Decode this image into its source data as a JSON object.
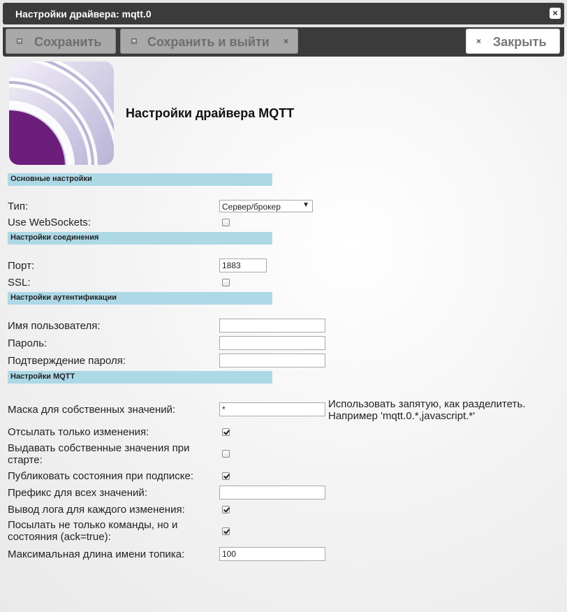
{
  "window": {
    "title": "Настройки драйвера: mqtt.0",
    "close_glyph": "×"
  },
  "toolbar": {
    "save_label": "Сохранить",
    "save_exit_label": "Сохранить и выйти",
    "close_label": "Закрыть",
    "x_glyph": "×"
  },
  "header": {
    "title": "Настройки драйвера MQTT",
    "logo_icon": "mqtt-logo-icon"
  },
  "sections": {
    "main": "Основные настройки",
    "connection": "Настройки соединения",
    "auth": "Настройки аутентификации",
    "mqtt": "Настройки MQTT"
  },
  "fields": {
    "type": {
      "label": "Тип:",
      "value": "Сервер/брокер",
      "arrow": "▼"
    },
    "websockets": {
      "label": "Use WebSockets:",
      "checked": false
    },
    "port": {
      "label": "Порт:",
      "value": "1883"
    },
    "ssl": {
      "label": "SSL:",
      "checked": false
    },
    "username": {
      "label": "Имя пользователя:",
      "value": ""
    },
    "password": {
      "label": "Пароль:",
      "value": ""
    },
    "password_confirm": {
      "label": "Подтверждение пароля:",
      "value": ""
    },
    "mask": {
      "label": "Маска для собственных значений:",
      "value": "*",
      "hint": "Использовать запятую, как разделитеть. Например 'mqtt.0.*,javascript.*'"
    },
    "only_changes": {
      "label": "Отсылать только изменения:",
      "checked": true
    },
    "initial_values": {
      "label": "Выдавать собственные значения при старте:",
      "checked": false
    },
    "publish_on_subscribe": {
      "label": "Публиковать состояния при подписке:",
      "checked": true
    },
    "prefix": {
      "label": "Префикс для всех значений:",
      "value": ""
    },
    "log_each_change": {
      "label": "Вывод лога для каждого изменения:",
      "checked": true
    },
    "send_ack_states": {
      "label": "Посылать не только команды, но и состояния (ack=true):",
      "checked": true
    },
    "max_topic_length": {
      "label": "Максимальная длина имени топика:",
      "value": "100"
    }
  },
  "colors": {
    "titlebar": "#3b3b3b",
    "section_header": "#add8e6",
    "logo_purple": "#6b1f7a"
  }
}
